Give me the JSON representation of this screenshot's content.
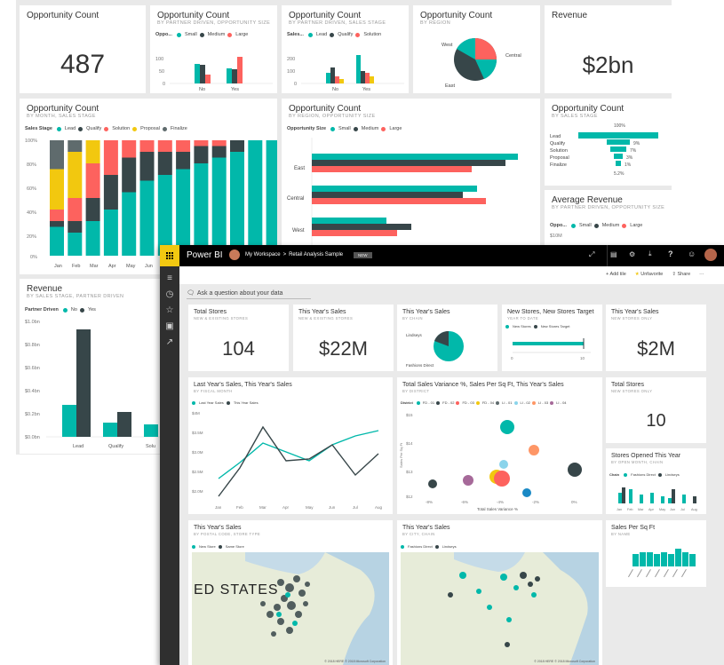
{
  "back": {
    "opp_count": {
      "title": "Opportunity Count",
      "value": "487"
    },
    "opp_partner": {
      "title": "Opportunity Count",
      "subtitle": "BY PARTNER DRIVEN, OPPORTUNITY SIZE",
      "legend_title": "Oppo...",
      "legend": [
        "Small",
        "Medium",
        "Large"
      ],
      "ticks": [
        "100",
        "50",
        "0"
      ],
      "categories": [
        "No",
        "Yes"
      ]
    },
    "opp_partner_sales": {
      "title": "Opportunity Count",
      "subtitle": "BY PARTNER DRIVEN, SALES STAGE",
      "legend_title": "Sales...",
      "legend": [
        "Lead",
        "Qualify",
        "Solution"
      ],
      "ticks": [
        "200",
        "100",
        "0"
      ],
      "categories": [
        "No",
        "Yes"
      ]
    },
    "opp_region": {
      "title": "Opportunity Count",
      "subtitle": "BY REGION",
      "labels": [
        "West",
        "Central",
        "East"
      ]
    },
    "revenue": {
      "title": "Revenue",
      "value": "$2bn"
    },
    "opp_month": {
      "title": "Opportunity Count",
      "subtitle": "BY MONTH, SALES STAGE",
      "legend_title": "Sales Stage",
      "legend": [
        "Lead",
        "Qualify",
        "Solution",
        "Proposal",
        "Finalize"
      ],
      "y_ticks": [
        "100%",
        "80%",
        "60%",
        "40%",
        "20%",
        "0%"
      ],
      "months": [
        "Jan",
        "Feb",
        "Mar",
        "Apr",
        "May",
        "Jun"
      ]
    },
    "opp_region_size": {
      "title": "Opportunity Count",
      "subtitle": "BY REGION, OPPORTUNITY SIZE",
      "legend_title": "Opportunity Size",
      "legend": [
        "Small",
        "Medium",
        "Large"
      ],
      "regions": [
        "East",
        "Central",
        "West"
      ]
    },
    "opp_stage": {
      "title": "Opportunity Count",
      "subtitle": "BY SALES STAGE",
      "pct_top": "100%",
      "stages": [
        "Lead",
        "Qualify",
        "Solution",
        "Proposal",
        "Finalize"
      ],
      "pcts": [
        "",
        "9%",
        "7%",
        "3%",
        "1%"
      ],
      "pct_bottom": "5.2%"
    },
    "avg_revenue": {
      "title": "Average Revenue",
      "subtitle": "BY PARTNER DRIVEN, OPPORTUNITY SIZE",
      "legend_title": "Oppo...",
      "legend": [
        "Small",
        "Medium",
        "Large"
      ],
      "tick": "$10M"
    },
    "rev_stage": {
      "title": "Revenue",
      "subtitle": "BY SALES STAGE, PARTNER DRIVEN",
      "legend_title": "Partner Driven",
      "legend": [
        "No",
        "Yes"
      ],
      "y_ticks": [
        "$1.0bn",
        "$0.8bn",
        "$0.6bn",
        "$0.4bn",
        "$0.2bn",
        "$0.0bn"
      ],
      "categories": [
        "Lead",
        "Qualify",
        "Solu"
      ]
    }
  },
  "front": {
    "app_name": "Power BI",
    "breadcrumb": [
      "My Workspace",
      ">",
      "Retail Analysis Sample"
    ],
    "badge": "NEW",
    "actions": {
      "add_tile": "Add tile",
      "unfavorite": "Unfavorite",
      "share": "Share",
      "more": "···"
    },
    "qna_placeholder": "Ask a question about your data",
    "total_stores": {
      "title": "Total Stores",
      "subtitle": "NEW & EXISTING STORES",
      "value": "104"
    },
    "this_year_sales": {
      "title": "This Year's Sales",
      "subtitle": "NEW & EXISTING STORES",
      "value": "$22M"
    },
    "sales_chain": {
      "title": "This Year's Sales",
      "subtitle": "BY CHAIN",
      "labels": [
        "Lindseys",
        "Fashions Direct"
      ]
    },
    "new_stores": {
      "title": "New Stores, New Stores Target",
      "subtitle": "YEAR TO DATE",
      "legend": [
        "New Stores",
        "New Stores Target"
      ],
      "ticks": [
        "0",
        "10"
      ]
    },
    "sales_new": {
      "title": "This Year's Sales",
      "subtitle": "NEW STORES ONLY",
      "value": "$2M"
    },
    "line_chart": {
      "title": "Last Year's Sales, This Year's Sales",
      "subtitle": "BY FISCAL MONTH",
      "legend": [
        "Last Year Sales",
        "This Year Sales"
      ],
      "y_ticks": [
        "$4M",
        "$3.5M",
        "$3.0M",
        "$2.5M",
        "$2.0M"
      ],
      "x_ticks": [
        "Jan",
        "Feb",
        "Mar",
        "Apr",
        "May",
        "Jun",
        "Jul",
        "Aug"
      ]
    },
    "scatter": {
      "title": "Total Sales Variance %, Sales Per Sq Ft, This Year's Sales",
      "subtitle": "BY DISTRICT",
      "legend_title": "District",
      "legend": [
        "FD - 01",
        "FD - 02",
        "FD - 03",
        "FD - 04",
        "LI - 01",
        "LI - 02",
        "LI - 03",
        "LI - 04"
      ],
      "y_ticks": [
        "$15",
        "$14",
        "$13",
        "$12"
      ],
      "x_ticks": [
        "-8%",
        "-6%",
        "-4%",
        "-2%",
        "0%"
      ],
      "xlabel": "Total Sales Variance %",
      "ylabel": "Sales Per Sq Ft"
    },
    "total_stores_new": {
      "title": "Total Stores",
      "subtitle": "NEW STORES ONLY",
      "value": "10"
    },
    "stores_opened": {
      "title": "Stores Opened This Year",
      "subtitle": "BY OPEN MONTH, CHAIN",
      "legend_title": "Chain",
      "legend": [
        "Fashions Direct",
        "Lindseys"
      ],
      "months": [
        "Jan",
        "Feb",
        "Mar",
        "Apr",
        "May",
        "Jun",
        "Jul",
        "Aug"
      ]
    },
    "map_zip": {
      "title": "This Year's Sales",
      "subtitle": "BY POSTAL CODE, STORE TYPE",
      "legend": [
        "New Store",
        "Same Store"
      ],
      "label": "ED STATES",
      "credit": "© 2018 HERE   © 2018 Microsoft Corporation"
    },
    "map_city": {
      "title": "This Year's Sales",
      "subtitle": "BY CITY, CHAIN",
      "legend": [
        "Fashions Direct",
        "Lindseys"
      ],
      "credit": "© 2018 HERE   © 2018 Microsoft Corporation"
    },
    "sales_sqft": {
      "title": "Sales Per Sq Ft",
      "subtitle": "BY NAME"
    }
  },
  "colors": {
    "teal": "#01b8aa",
    "dark": "#374649",
    "red": "#fd625e",
    "yellow": "#f2c80f",
    "gray": "#5f6b6d",
    "brand": "#f2c811"
  }
}
